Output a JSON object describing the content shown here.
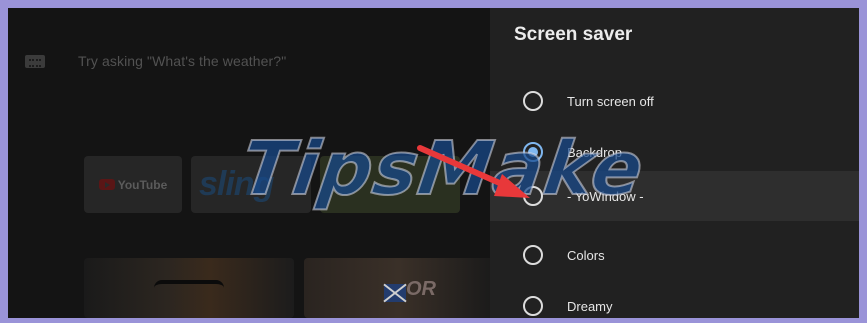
{
  "home": {
    "assistant_hint": "Try asking \"What's the weather?\"",
    "apps": [
      {
        "name": "YouTube"
      },
      {
        "name": "sling"
      }
    ],
    "thumb_badge": "OR"
  },
  "watermark": "TipsMake",
  "panel": {
    "title": "Screen saver",
    "options": [
      {
        "label": "Turn screen off",
        "selected": false
      },
      {
        "label": "Backdrop",
        "selected": true
      },
      {
        "label": "- YoWindow -",
        "selected": false,
        "focused": true
      },
      {
        "label": "Colors",
        "selected": false
      },
      {
        "label": "Dreamy",
        "selected": false
      }
    ]
  },
  "colors": {
    "frame_border": "#9a93d8",
    "panel_bg": "#212121",
    "radio_selected": "#7fb7f0",
    "arrow": "#e8383a"
  },
  "icons": {
    "assistant": "keyboard-icon",
    "arrow": "red-arrow-annotation-icon"
  }
}
